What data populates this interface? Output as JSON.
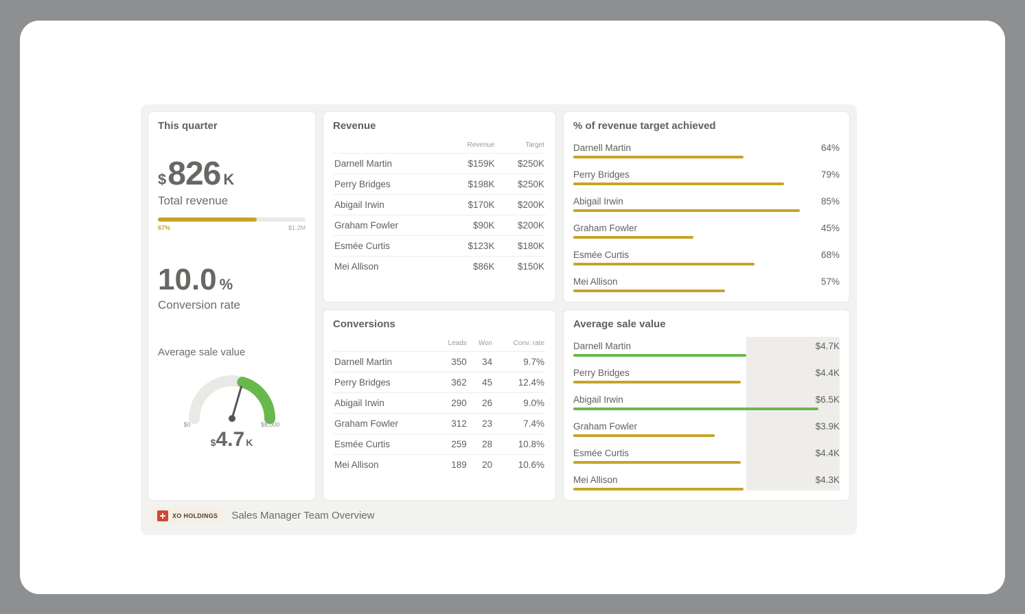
{
  "quarter": {
    "title": "This quarter",
    "revenue_currency": "$",
    "revenue_number": "826",
    "revenue_suffix": "K",
    "revenue_label": "Total revenue",
    "progress_pct_label": "67%",
    "progress_pct": 67,
    "progress_max_label": "$1.2M",
    "conversion_number": "10.0",
    "conversion_suffix": "%",
    "conversion_label": "Conversion rate",
    "gauge_title": "Average sale value",
    "gauge_min_label": "$0",
    "gauge_max_label": "$8,000",
    "gauge_currency": "$",
    "gauge_number": "4.7",
    "gauge_suffix": "K",
    "gauge_fraction": 0.59
  },
  "revenue": {
    "title": "Revenue",
    "headers": {
      "name": "",
      "revenue": "Revenue",
      "target": "Target"
    },
    "rows": [
      {
        "name": "Darnell Martin",
        "revenue": "$159K",
        "target": "$250K"
      },
      {
        "name": "Perry Bridges",
        "revenue": "$198K",
        "target": "$250K"
      },
      {
        "name": "Abigail Irwin",
        "revenue": "$170K",
        "target": "$200K"
      },
      {
        "name": "Graham Fowler",
        "revenue": "$90K",
        "target": "$200K"
      },
      {
        "name": "Esmée Curtis",
        "revenue": "$123K",
        "target": "$180K"
      },
      {
        "name": "Mei Allison",
        "revenue": "$86K",
        "target": "$150K"
      }
    ]
  },
  "conversions": {
    "title": "Conversions",
    "headers": {
      "name": "",
      "leads": "Leads",
      "won": "Won",
      "rate": "Conv. rate"
    },
    "rows": [
      {
        "name": "Darnell Martin",
        "leads": "350",
        "won": "34",
        "rate": "9.7%"
      },
      {
        "name": "Perry Bridges",
        "leads": "362",
        "won": "45",
        "rate": "12.4%"
      },
      {
        "name": "Abigail Irwin",
        "leads": "290",
        "won": "26",
        "rate": "9.0%"
      },
      {
        "name": "Graham Fowler",
        "leads": "312",
        "won": "23",
        "rate": "7.4%"
      },
      {
        "name": "Esmée Curtis",
        "leads": "259",
        "won": "28",
        "rate": "10.8%"
      },
      {
        "name": "Mei Allison",
        "leads": "189",
        "won": "20",
        "rate": "10.6%"
      }
    ]
  },
  "target_pct": {
    "title": "% of revenue target achieved",
    "rows": [
      {
        "name": "Darnell Martin",
        "pct_label": "64%",
        "pct": 64
      },
      {
        "name": "Perry Bridges",
        "pct_label": "79%",
        "pct": 79
      },
      {
        "name": "Abigail Irwin",
        "pct_label": "85%",
        "pct": 85
      },
      {
        "name": "Graham Fowler",
        "pct_label": "45%",
        "pct": 45
      },
      {
        "name": "Esmée Curtis",
        "pct_label": "68%",
        "pct": 68
      },
      {
        "name": "Mei Allison",
        "pct_label": "57%",
        "pct": 57
      }
    ]
  },
  "avg_sale": {
    "title": "Average sale value",
    "threshold_left_pct": 65,
    "threshold_width_pct": 35,
    "rows": [
      {
        "name": "Darnell Martin",
        "value": "$4.7K",
        "pct": 65,
        "green": true
      },
      {
        "name": "Perry Bridges",
        "value": "$4.4K",
        "pct": 63,
        "green": false
      },
      {
        "name": "Abigail Irwin",
        "value": "$6.5K",
        "pct": 92,
        "green": true
      },
      {
        "name": "Graham Fowler",
        "value": "$3.9K",
        "pct": 53,
        "green": false
      },
      {
        "name": "Esmée Curtis",
        "value": "$4.4K",
        "pct": 63,
        "green": false
      },
      {
        "name": "Mei Allison",
        "value": "$4.3K",
        "pct": 64,
        "green": false
      }
    ]
  },
  "footer": {
    "brand": "XO HOLDINGS",
    "title": "Sales Manager Team Overview"
  },
  "chart_data": [
    {
      "type": "bar",
      "title": "% of revenue target achieved",
      "orientation": "horizontal",
      "xlabel": "",
      "ylabel": "",
      "xlim": [
        0,
        100
      ],
      "categories": [
        "Darnell Martin",
        "Perry Bridges",
        "Abigail Irwin",
        "Graham Fowler",
        "Esmée Curtis",
        "Mei Allison"
      ],
      "values": [
        64,
        79,
        85,
        45,
        68,
        57
      ]
    },
    {
      "type": "bar",
      "title": "Average sale value",
      "orientation": "horizontal",
      "xlabel": "",
      "ylabel": "",
      "unit": "$K",
      "categories": [
        "Darnell Martin",
        "Perry Bridges",
        "Abigail Irwin",
        "Graham Fowler",
        "Esmée Curtis",
        "Mei Allison"
      ],
      "values": [
        4.7,
        4.4,
        6.5,
        3.9,
        4.4,
        4.3
      ],
      "threshold_band": {
        "from_pct": 65,
        "to_pct": 100
      }
    },
    {
      "type": "table",
      "title": "Revenue",
      "columns": [
        "Name",
        "Revenue",
        "Target"
      ],
      "rows": [
        [
          "Darnell Martin",
          "$159K",
          "$250K"
        ],
        [
          "Perry Bridges",
          "$198K",
          "$250K"
        ],
        [
          "Abigail Irwin",
          "$170K",
          "$200K"
        ],
        [
          "Graham Fowler",
          "$90K",
          "$200K"
        ],
        [
          "Esmée Curtis",
          "$123K",
          "$180K"
        ],
        [
          "Mei Allison",
          "$86K",
          "$150K"
        ]
      ]
    },
    {
      "type": "table",
      "title": "Conversions",
      "columns": [
        "Name",
        "Leads",
        "Won",
        "Conv. rate"
      ],
      "rows": [
        [
          "Darnell Martin",
          "350",
          "34",
          "9.7%"
        ],
        [
          "Perry Bridges",
          "362",
          "45",
          "12.4%"
        ],
        [
          "Abigail Irwin",
          "290",
          "26",
          "9.0%"
        ],
        [
          "Graham Fowler",
          "312",
          "23",
          "7.4%"
        ],
        [
          "Esmée Curtis",
          "259",
          "28",
          "10.8%"
        ],
        [
          "Mei Allison",
          "189",
          "20",
          "10.6%"
        ]
      ]
    },
    {
      "type": "gauge",
      "title": "Average sale value",
      "min": 0,
      "max": 8000,
      "value": 4700,
      "min_label": "$0",
      "max_label": "$8,000",
      "value_label": "$4.7K"
    }
  ]
}
